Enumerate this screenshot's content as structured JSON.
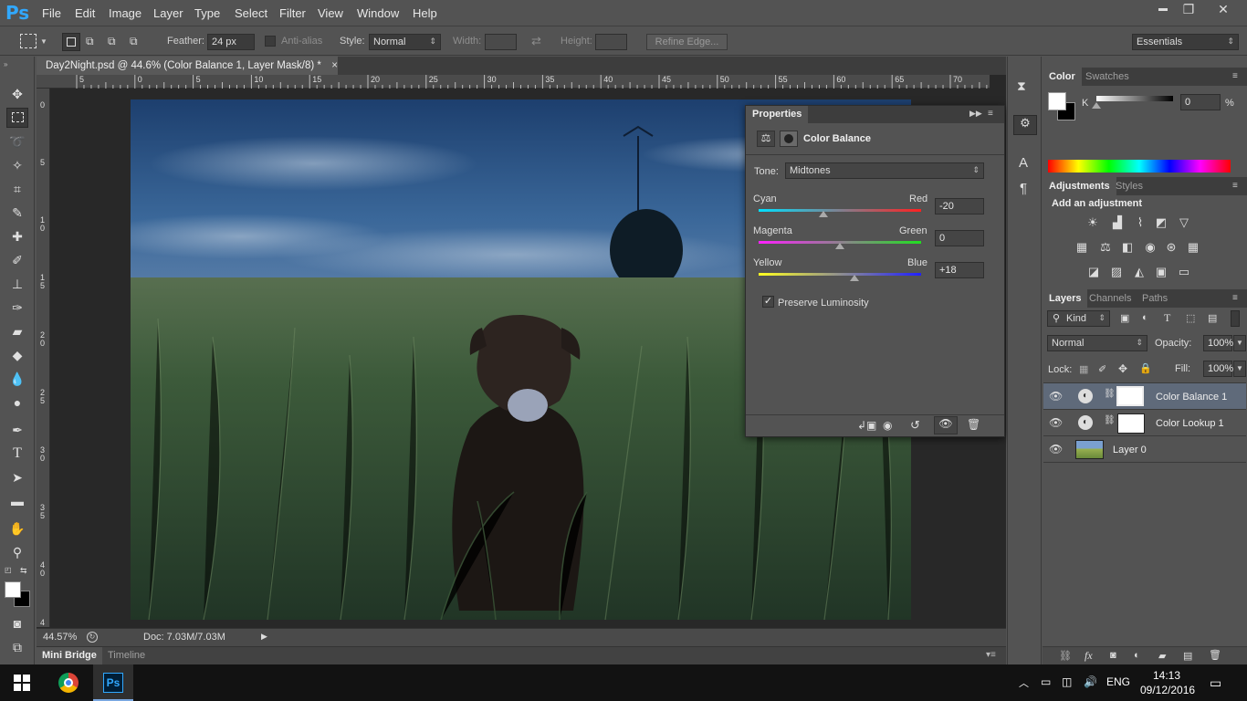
{
  "app": {
    "logo": "Ps"
  },
  "menu": [
    "File",
    "Edit",
    "Image",
    "Layer",
    "Type",
    "Select",
    "Filter",
    "View",
    "Window",
    "Help"
  ],
  "window_controls": {
    "minimize": "▬",
    "restore": "❐",
    "close": "✕"
  },
  "options": {
    "feather_label": "Feather:",
    "feather_value": "24 px",
    "antialias_label": "Anti-alias",
    "style_label": "Style:",
    "style_value": "Normal",
    "width_label": "Width:",
    "height_label": "Height:",
    "refine_edge": "Refine Edge...",
    "workspace": "Essentials"
  },
  "document": {
    "tab_title": "Day2Night.psd @ 44.6% (Color Balance 1, Layer Mask/8) *",
    "close": "×",
    "zoom": "44.57%",
    "doc_info": "Doc: 7.03M/7.03M"
  },
  "ruler_top": [
    "5",
    "0",
    "5",
    "10",
    "15",
    "20",
    "25",
    "30",
    "35",
    "40",
    "45",
    "50",
    "55",
    "60",
    "65",
    "70"
  ],
  "ruler_left": [
    "0",
    "5",
    "1\n0",
    "1\n5",
    "2\n0",
    "2\n5",
    "3\n0",
    "3\n5",
    "4\n0",
    "4"
  ],
  "bottom_tabs": [
    "Mini Bridge",
    "Timeline"
  ],
  "properties": {
    "tab": "Properties",
    "title": "Color Balance",
    "tone_label": "Tone:",
    "tone_value": "Midtones",
    "sliders": [
      {
        "left": "Cyan",
        "right": "Red",
        "value": "-20",
        "fraction": 0.4,
        "colors": [
          "#00e0ff",
          "#ff2020"
        ]
      },
      {
        "left": "Magenta",
        "right": "Green",
        "value": "0",
        "fraction": 0.5,
        "colors": [
          "#ff20ff",
          "#20e020"
        ]
      },
      {
        "left": "Yellow",
        "right": "Blue",
        "value": "+18",
        "fraction": 0.59,
        "colors": [
          "#ffff20",
          "#2020ff"
        ]
      }
    ],
    "preserve_label": "Preserve Luminosity",
    "preserve_checked": "✓"
  },
  "color_panel": {
    "tabs": [
      "Color",
      "Swatches"
    ],
    "channel": "K",
    "value": "0",
    "unit": "%"
  },
  "adjustments_panel": {
    "tabs": [
      "Adjustments",
      "Styles"
    ],
    "heading": "Add an adjustment",
    "icons": [
      [
        "sun-icon",
        "☀"
      ],
      [
        "levels-icon",
        "▟"
      ],
      [
        "curves-icon",
        "⌇"
      ],
      [
        "exposure-icon",
        "◩"
      ],
      [
        "gradient-triangle-icon",
        "▽"
      ],
      [
        "vibrance-icon",
        "▦"
      ],
      [
        "balance-scale-icon",
        "⚖"
      ],
      [
        "bw-icon",
        "◧"
      ],
      [
        "photo-filter-icon",
        "◉"
      ],
      [
        "channel-mixer-icon",
        "⊛"
      ],
      [
        "lookup-grid-icon",
        "▦"
      ],
      [
        "invert-icon",
        "◪"
      ],
      [
        "posterize-icon",
        "▨"
      ],
      [
        "threshold-icon",
        "◭"
      ],
      [
        "selective-color-icon",
        "▣"
      ],
      [
        "gradient-map-icon",
        "▭"
      ]
    ]
  },
  "layers_panel": {
    "tabs": [
      "Layers",
      "Channels",
      "Paths"
    ],
    "filter_label": "Kind",
    "blend_mode": "Normal",
    "opacity_label": "Opacity:",
    "opacity_value": "100%",
    "lock_label": "Lock:",
    "fill_label": "Fill:",
    "fill_value": "100%",
    "layers": [
      {
        "name": "Color Balance 1",
        "selected": true,
        "type": "adjustment"
      },
      {
        "name": "Color Lookup 1",
        "selected": false,
        "type": "adjustment"
      },
      {
        "name": "Layer 0",
        "selected": false,
        "type": "image"
      }
    ]
  },
  "taskbar": {
    "lang": "ENG",
    "time": "14:13",
    "date": "09/12/2016",
    "ps_label": "Ps"
  }
}
